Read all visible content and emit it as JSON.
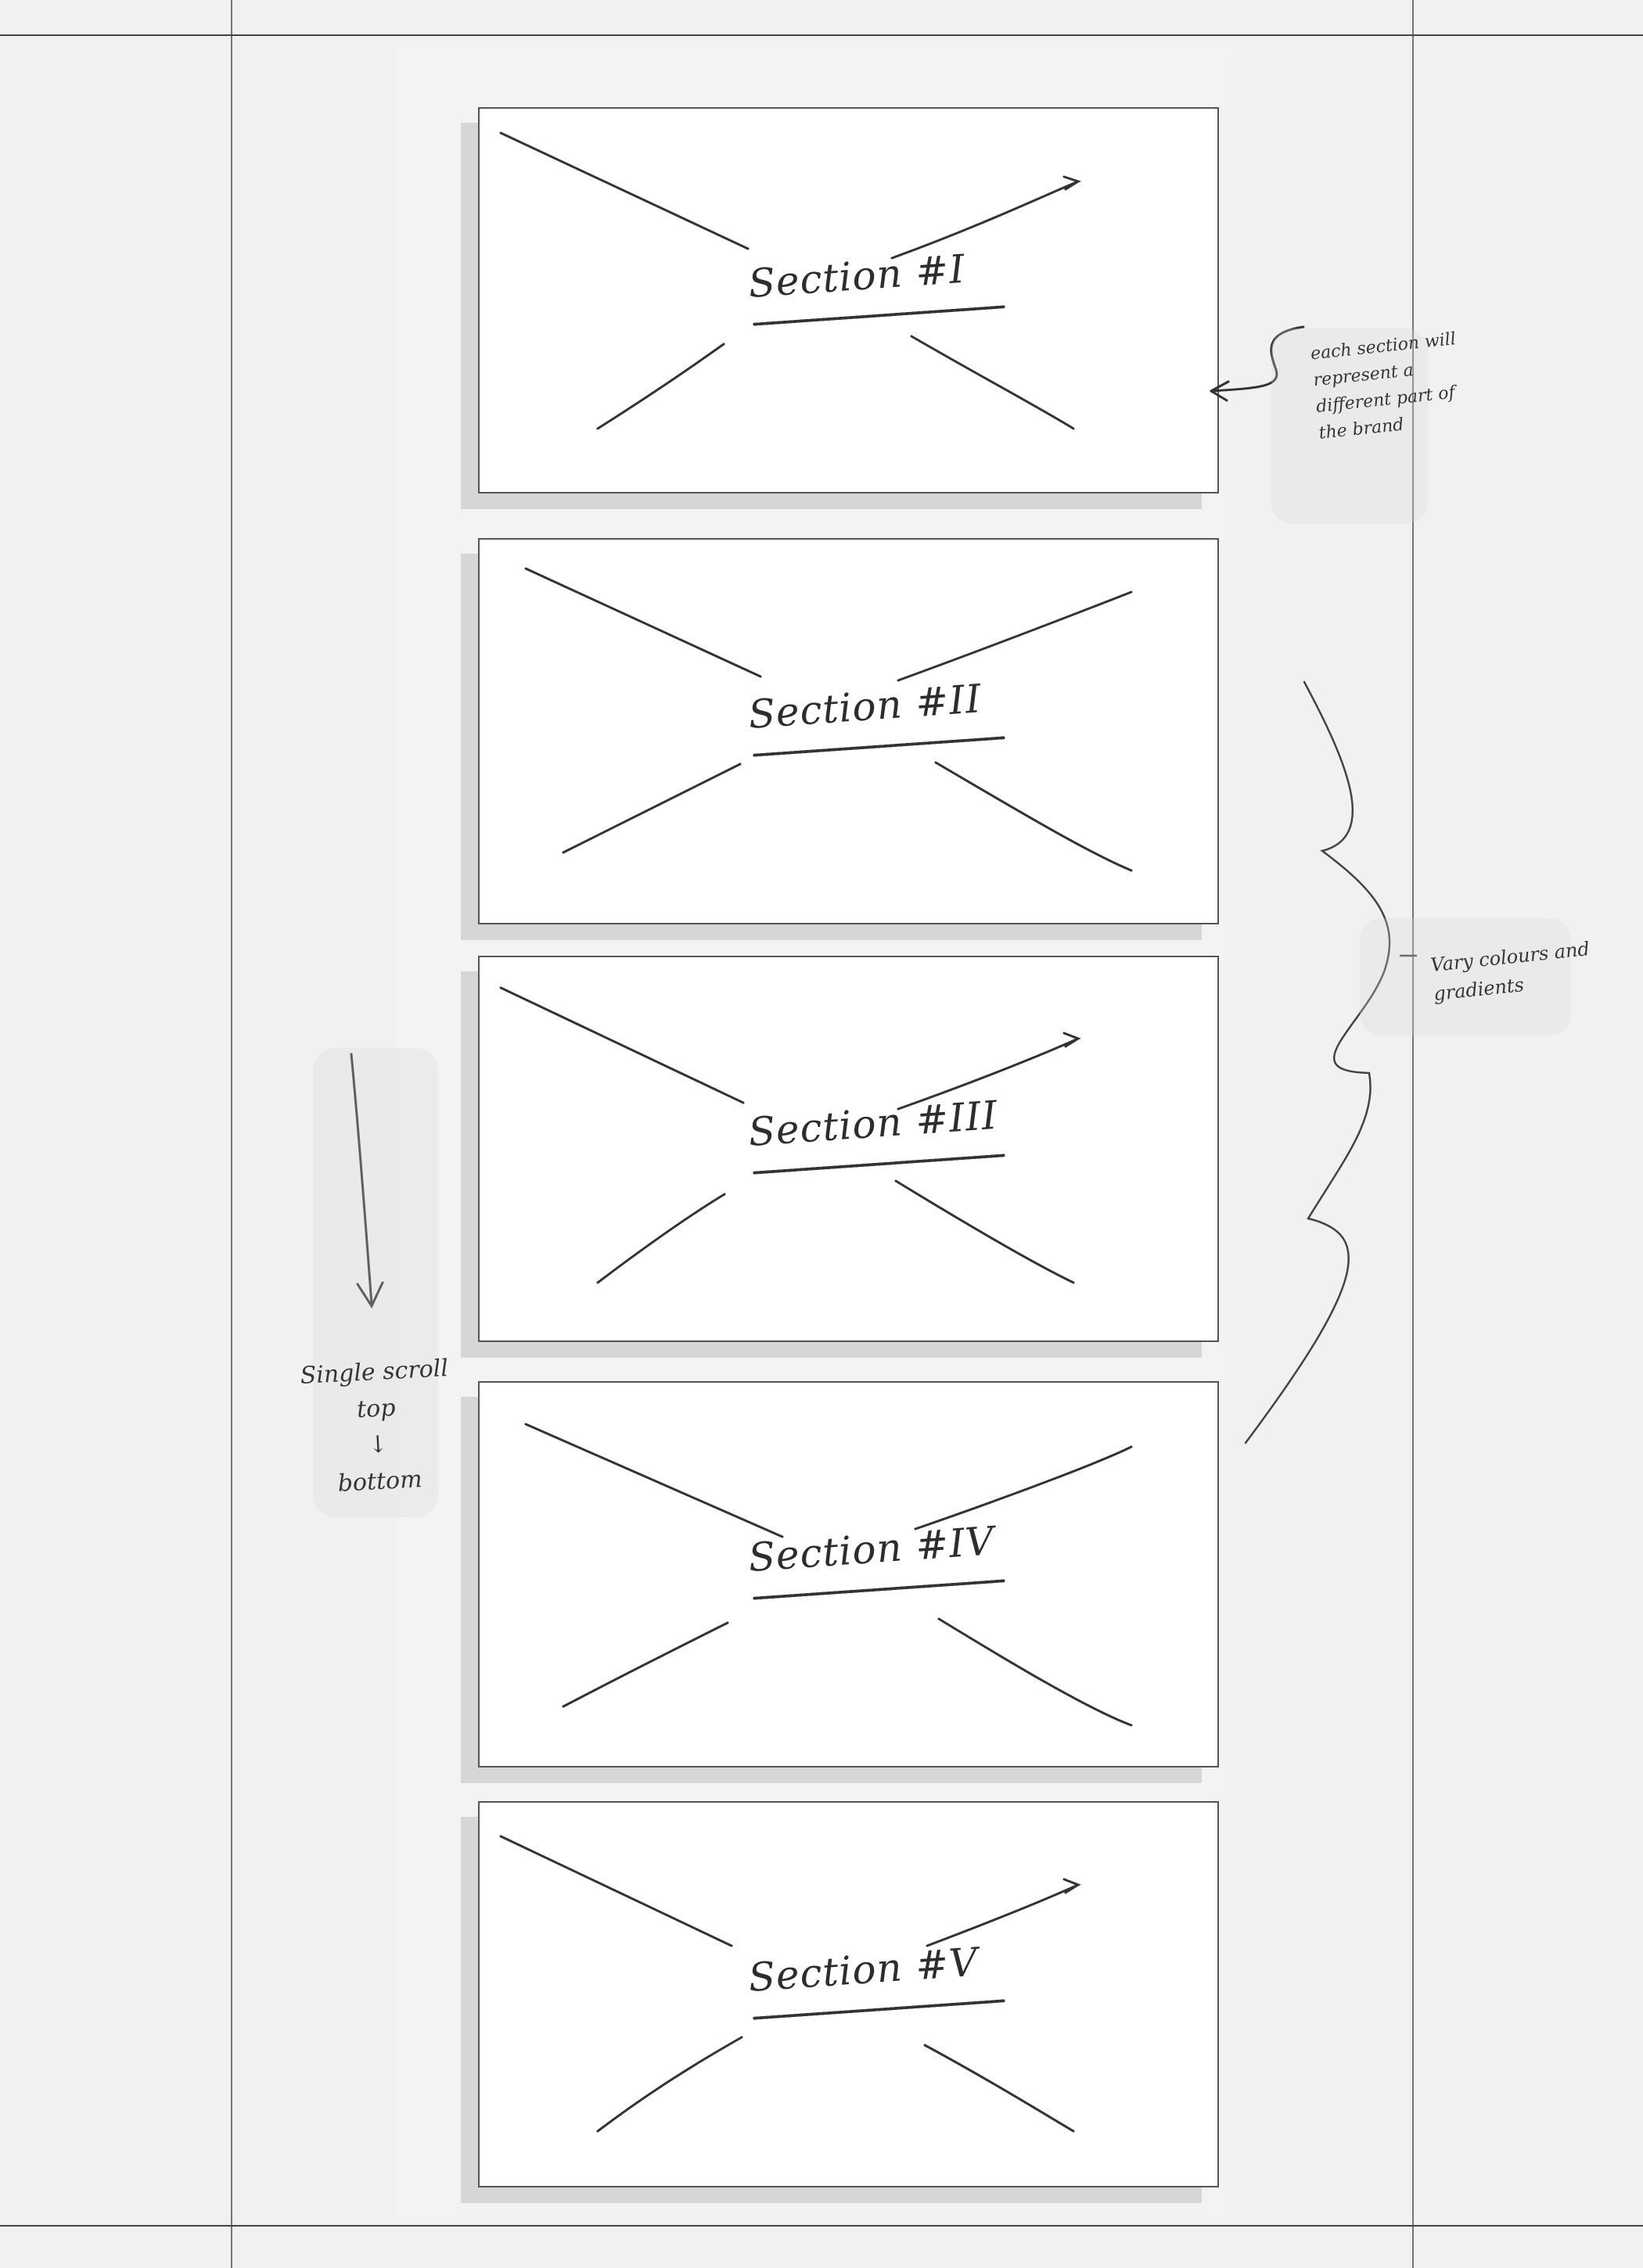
{
  "sections": [
    {
      "label": "Section #I"
    },
    {
      "label": "Section #II"
    },
    {
      "label": "Section #III"
    },
    {
      "label": "Section #IV"
    },
    {
      "label": "Section #V"
    }
  ],
  "annotations": {
    "each_section": "each section will represent a different part of the brand",
    "colours": "Vary colours and gradients",
    "scroll": "Single scroll\ntop\n↓\nbottom"
  },
  "colors": {
    "paper": "#f1f1f1",
    "card": "#ffffff",
    "ink": "#2d2d2d",
    "shadow": "#d6d6d6"
  },
  "icons": {
    "down_arrow": "scroll-arrow-icon",
    "left_arrow": "pointer-arrow-icon"
  }
}
